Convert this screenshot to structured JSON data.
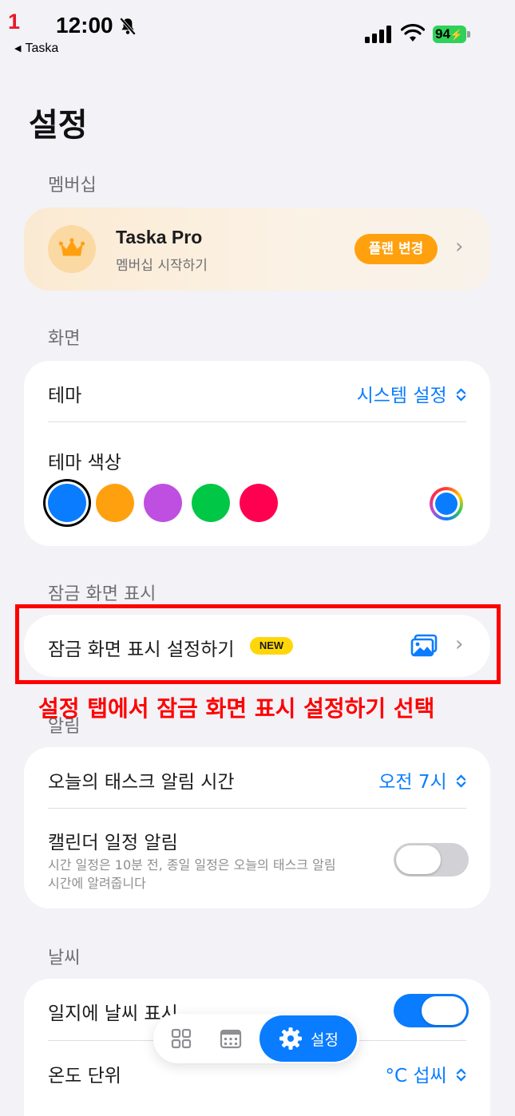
{
  "status_bar": {
    "step_number": "1",
    "time": "12:00",
    "back_app": "Taska",
    "battery": "94"
  },
  "page_title": "설정",
  "sections": {
    "membership": {
      "header": "멤버십",
      "title": "Taska Pro",
      "subtitle": "멤버십 시작하기",
      "plan_button": "플랜 변경"
    },
    "display": {
      "header": "화면",
      "theme_label": "테마",
      "theme_value": "시스템 설정",
      "theme_color_label": "테마 색상",
      "colors": [
        "#0a7cff",
        "#ffa00f",
        "#bf4fe0",
        "#00c746",
        "#ff0050"
      ]
    },
    "lock_screen": {
      "header": "잠금 화면 표시",
      "row_label": "잠금 화면 표시 설정하기",
      "badge": "NEW"
    },
    "annotation": "설정 탭에서 잠금 화면 표시 설정하기 선택",
    "notifications": {
      "header": "알림",
      "task_alarm_label": "오늘의 태스크 알림 시간",
      "task_alarm_value": "오전 7시",
      "calendar_label": "캘린더 일정 알림",
      "calendar_desc_line1": "시간 일정은 10분 전, 종일 일정은 오늘의 태스크 알림",
      "calendar_desc_line2": "시간에 알려줍니다",
      "calendar_toggle_on": false
    },
    "weather": {
      "header": "날씨",
      "journal_weather_label": "일지에 날씨 표시",
      "journal_weather_on": true,
      "temp_unit_label": "온도 단위",
      "temp_unit_value": "°C 섭씨"
    }
  },
  "tab_bar": {
    "settings_label": "설정"
  }
}
